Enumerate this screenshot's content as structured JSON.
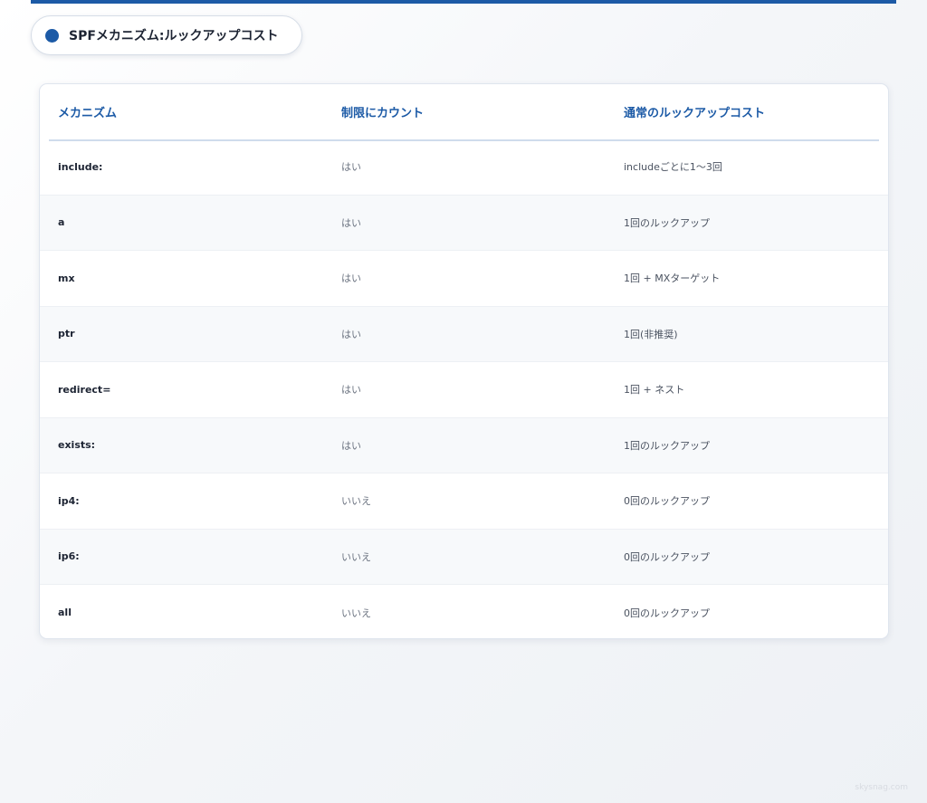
{
  "title": "SPFメカニズム:ルックアップコスト",
  "table": {
    "headers": [
      "メカニズム",
      "制限にカウント",
      "通常のルックアップコスト"
    ],
    "rows": [
      {
        "mechanism": "include:",
        "counts": "はい",
        "cost": "includeごとに1〜3回"
      },
      {
        "mechanism": "a",
        "counts": "はい",
        "cost": "1回のルックアップ"
      },
      {
        "mechanism": "mx",
        "counts": "はい",
        "cost": "1回 + MXターゲット"
      },
      {
        "mechanism": "ptr",
        "counts": "はい",
        "cost": "1回(非推奨)"
      },
      {
        "mechanism": "redirect=",
        "counts": "はい",
        "cost": "1回 + ネスト"
      },
      {
        "mechanism": "exists:",
        "counts": "はい",
        "cost": "1回のルックアップ"
      },
      {
        "mechanism": "ip4:",
        "counts": "いいえ",
        "cost": "0回のルックアップ"
      },
      {
        "mechanism": "ip6:",
        "counts": "いいえ",
        "cost": "0回のルックアップ"
      },
      {
        "mechanism": "all",
        "counts": "いいえ",
        "cost": "0回のルックアップ"
      }
    ]
  },
  "watermark": "skysnag.com",
  "colors": {
    "accent": "#1c5aa6",
    "header_text": "#1c5aa6"
  }
}
